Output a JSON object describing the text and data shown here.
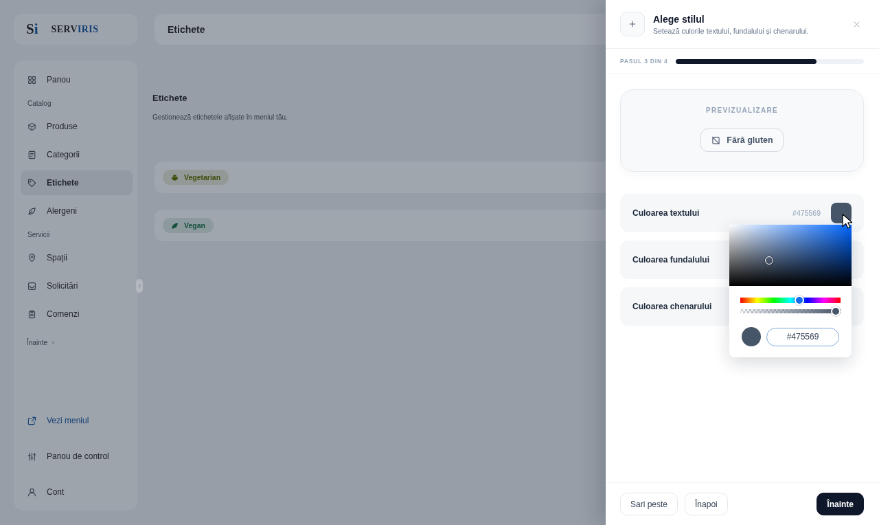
{
  "sidebar": {
    "logo": {
      "mark": {
        "main": "S",
        "accent": "i"
      },
      "wordmark": {
        "main": "SERV",
        "accent": "IRIS"
      }
    },
    "nav": [
      {
        "kind": "item",
        "label": "Panou",
        "selected": false
      },
      {
        "kind": "section",
        "label": "Catalog"
      },
      {
        "kind": "item",
        "label": "Produse",
        "selected": false
      },
      {
        "kind": "item",
        "label": "Categorii",
        "selected": false
      },
      {
        "kind": "item",
        "label": "Etichete",
        "selected": true
      },
      {
        "kind": "item",
        "label": "Alergeni",
        "selected": false
      },
      {
        "kind": "section",
        "label": "Servicii"
      },
      {
        "kind": "item",
        "label": "Spații",
        "selected": false
      },
      {
        "kind": "item",
        "label": "Solicitări",
        "selected": false
      },
      {
        "kind": "item",
        "label": "Comenzi",
        "selected": false
      },
      {
        "kind": "more",
        "label": "Înainte"
      }
    ],
    "footer_nav": [
      {
        "kind": "link",
        "label": "Vezi meniul",
        "selected": false
      },
      {
        "kind": "item",
        "label": "Panou de control",
        "selected": false
      },
      {
        "kind": "item",
        "label": "Cont",
        "selected": false
      }
    ]
  },
  "header": {
    "title": "Etichete"
  },
  "page": {
    "title": "Etichete",
    "subtitle": "Gestionează etichetele afișate în meniul tău."
  },
  "tags": [
    {
      "label": "Vegetarian",
      "color": "#3f4d0c"
    },
    {
      "label": "Vegan",
      "color": "#12503c"
    }
  ],
  "drawer": {
    "title": "Alege stilul",
    "subtitle": "Setează culorile textului, fundalului și chenarului.",
    "step": {
      "label": "PASUL 3 DIN 4",
      "level": 0.75
    },
    "preview": {
      "label": "PREVIZUALIZARE",
      "tag": "Fără gluten"
    },
    "color_rows": [
      {
        "label": "Culoarea textului",
        "value": "#475569",
        "color": "#475569"
      },
      {
        "label": "Culoarea fundalului"
      },
      {
        "label": "Culoarea chenarului"
      }
    ],
    "picker": {
      "color": "#475569",
      "value": "#475569",
      "hue": {
        "level": 0.6
      },
      "alpha": {
        "level": 1
      }
    },
    "buttons": [
      {
        "label": "Sari peste",
        "kind": "secondary"
      },
      {
        "label": "Înapoi",
        "kind": "secondary"
      },
      {
        "label": "Înainte",
        "kind": "primary"
      }
    ]
  }
}
